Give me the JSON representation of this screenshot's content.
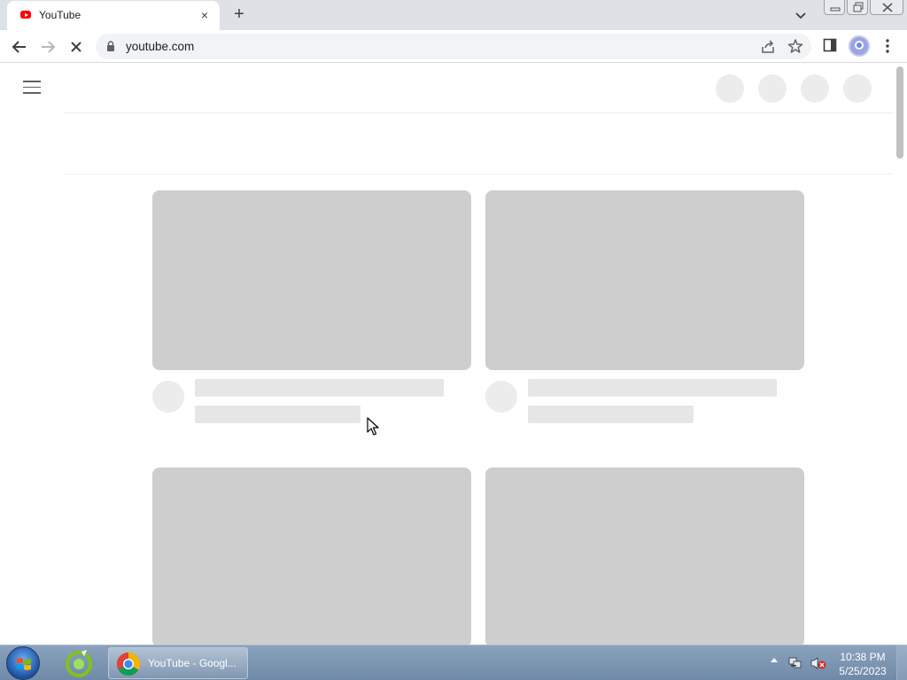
{
  "browser": {
    "tab": {
      "title": "YouTube",
      "close_glyph": "×",
      "favicon": "youtube-favicon-icon"
    },
    "new_tab_glyph": "+",
    "url": "youtube.com",
    "icons": [
      "back-icon",
      "forward-icon",
      "stop-icon",
      "lock-icon",
      "share-icon",
      "star-icon",
      "side-panel-icon",
      "profile-avatar",
      "menu-kebab-icon",
      "tab-search-icon"
    ]
  },
  "page": {
    "state": "loading-skeleton",
    "placeholder_color": "#cecece",
    "cards": 4
  },
  "taskbar": {
    "task_label": "YouTube - Googl...",
    "time": "10:38 PM",
    "date": "5/25/2023"
  },
  "colors": {
    "tabstrip": "#dee1e6",
    "youtube_red": "#ff0000",
    "taskbar": "#7b94b1"
  }
}
